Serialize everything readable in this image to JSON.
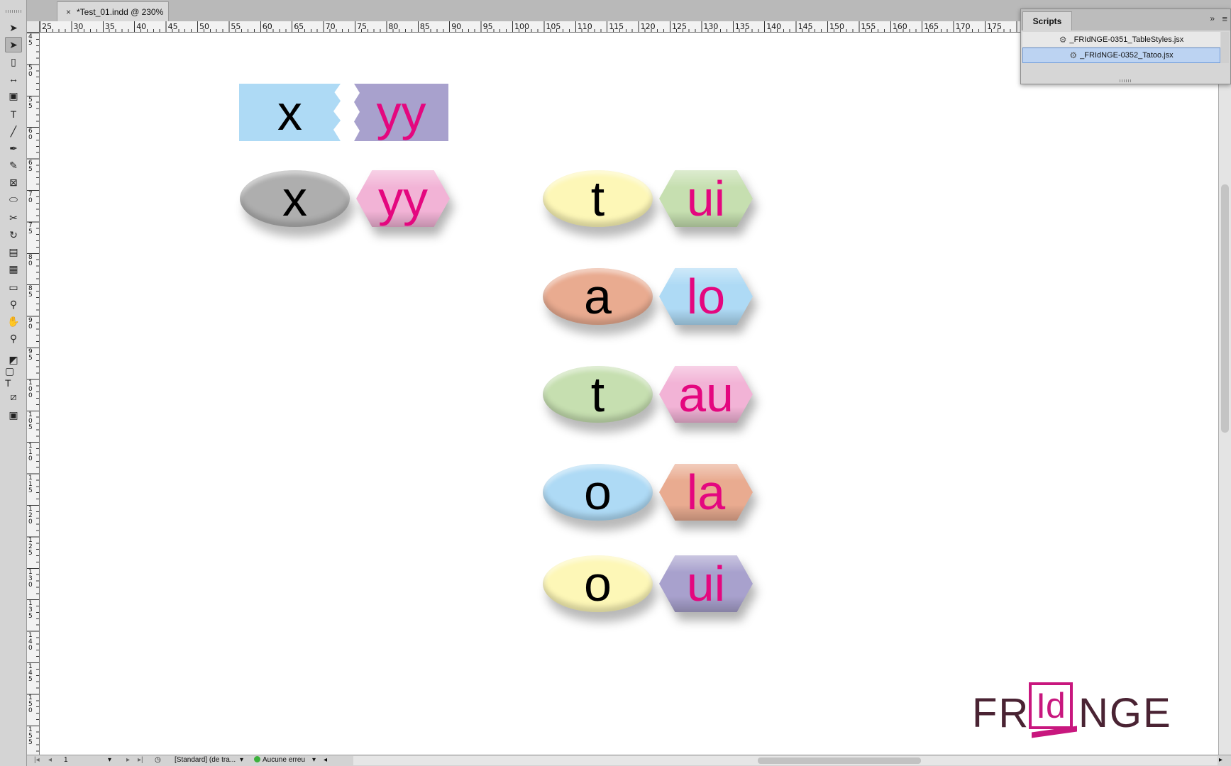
{
  "document": {
    "tab_title": "*Test_01.indd @ 230%",
    "close_glyph": "×"
  },
  "ruler": {
    "horizontal_labels": [
      "25",
      "30",
      "35",
      "40",
      "45",
      "50",
      "55",
      "60",
      "65",
      "70",
      "75",
      "80",
      "85",
      "90",
      "95",
      "100",
      "105",
      "110",
      "115",
      "120",
      "125",
      "130",
      "135",
      "140",
      "145",
      "150",
      "155",
      "160",
      "165",
      "170",
      "175"
    ],
    "vertical_labels": [
      "45",
      "50",
      "55",
      "60",
      "65",
      "70",
      "75",
      "80",
      "85",
      "90",
      "95",
      "100",
      "105",
      "110",
      "115",
      "120",
      "125",
      "130",
      "135",
      "140",
      "145",
      "150",
      "155"
    ]
  },
  "tools": [
    {
      "name": "selection-tool-icon",
      "glyph": "➤"
    },
    {
      "name": "direct-selection-tool-icon",
      "glyph": "➤",
      "selected": true
    },
    {
      "name": "page-tool-icon",
      "glyph": "▯"
    },
    {
      "name": "gap-tool-icon",
      "glyph": "↔"
    },
    {
      "name": "content-collector-icon",
      "glyph": "▣"
    },
    {
      "name": "type-tool-icon",
      "glyph": "T"
    },
    {
      "name": "line-tool-icon",
      "glyph": "╱"
    },
    {
      "name": "pen-tool-icon",
      "glyph": "✒"
    },
    {
      "name": "pencil-tool-icon",
      "glyph": "✎"
    },
    {
      "name": "rectangle-frame-tool-icon",
      "glyph": "⊠"
    },
    {
      "name": "ellipse-tool-icon",
      "glyph": "⬭"
    },
    {
      "name": "scissors-tool-icon",
      "glyph": "✂"
    },
    {
      "name": "rotate-tool-icon",
      "glyph": "↻"
    },
    {
      "name": "gradient-tool-icon",
      "glyph": "▤"
    },
    {
      "name": "gradient-feather-tool-icon",
      "glyph": "▦"
    },
    {
      "name": "note-tool-icon",
      "glyph": "▭"
    },
    {
      "name": "eyedropper-tool-icon",
      "glyph": "⚲"
    },
    {
      "name": "hand-tool-icon",
      "glyph": "✋"
    },
    {
      "name": "zoom-tool-icon",
      "glyph": "⚲"
    },
    {
      "name": "fill-stroke-icon",
      "glyph": "◩"
    },
    {
      "name": "formatting-container-icon",
      "glyph": "▢ T"
    },
    {
      "name": "apply-none-icon",
      "glyph": "⧄"
    },
    {
      "name": "screen-mode-icon",
      "glyph": "▣"
    }
  ],
  "scripts_panel": {
    "title": "Scripts",
    "collapse_glyph": "»",
    "menu_glyph": "≡",
    "items": [
      {
        "label": "_FRIdNGE-0351_TableStyles.jsx",
        "selected": false
      },
      {
        "label": "_FRIdNGE-0352_Tatoo.jsx",
        "selected": true
      }
    ]
  },
  "canvas": {
    "row_top": {
      "left": "x",
      "right": "yy"
    },
    "row_second": {
      "left": "x",
      "right": "yy"
    },
    "pairs": [
      {
        "left": "t",
        "right": "ui"
      },
      {
        "left": "a",
        "right": "lo"
      },
      {
        "left": "t",
        "right": "au"
      },
      {
        "left": "o",
        "right": "la"
      },
      {
        "left": "o",
        "right": "ui"
      }
    ]
  },
  "colors": {
    "light_blue": "#aedaf5",
    "lavender": "#a8a1cd",
    "grey": "#aeaeae",
    "pink_fill": "#f2b3d6",
    "yellow": "#fdf7b7",
    "green": "#c6dfb0",
    "salmon": "#e9ab90",
    "text_pink": "#e4077f",
    "logo_dark": "#4a2333",
    "logo_magenta": "#c8177e"
  },
  "logo": {
    "left_text": "FR",
    "box_text": "Id",
    "right_text": "NGE"
  },
  "status_bar": {
    "page_number": "1",
    "preflight_profile": "[Standard] (de tra...",
    "preflight_status": "Aucune erreu"
  }
}
